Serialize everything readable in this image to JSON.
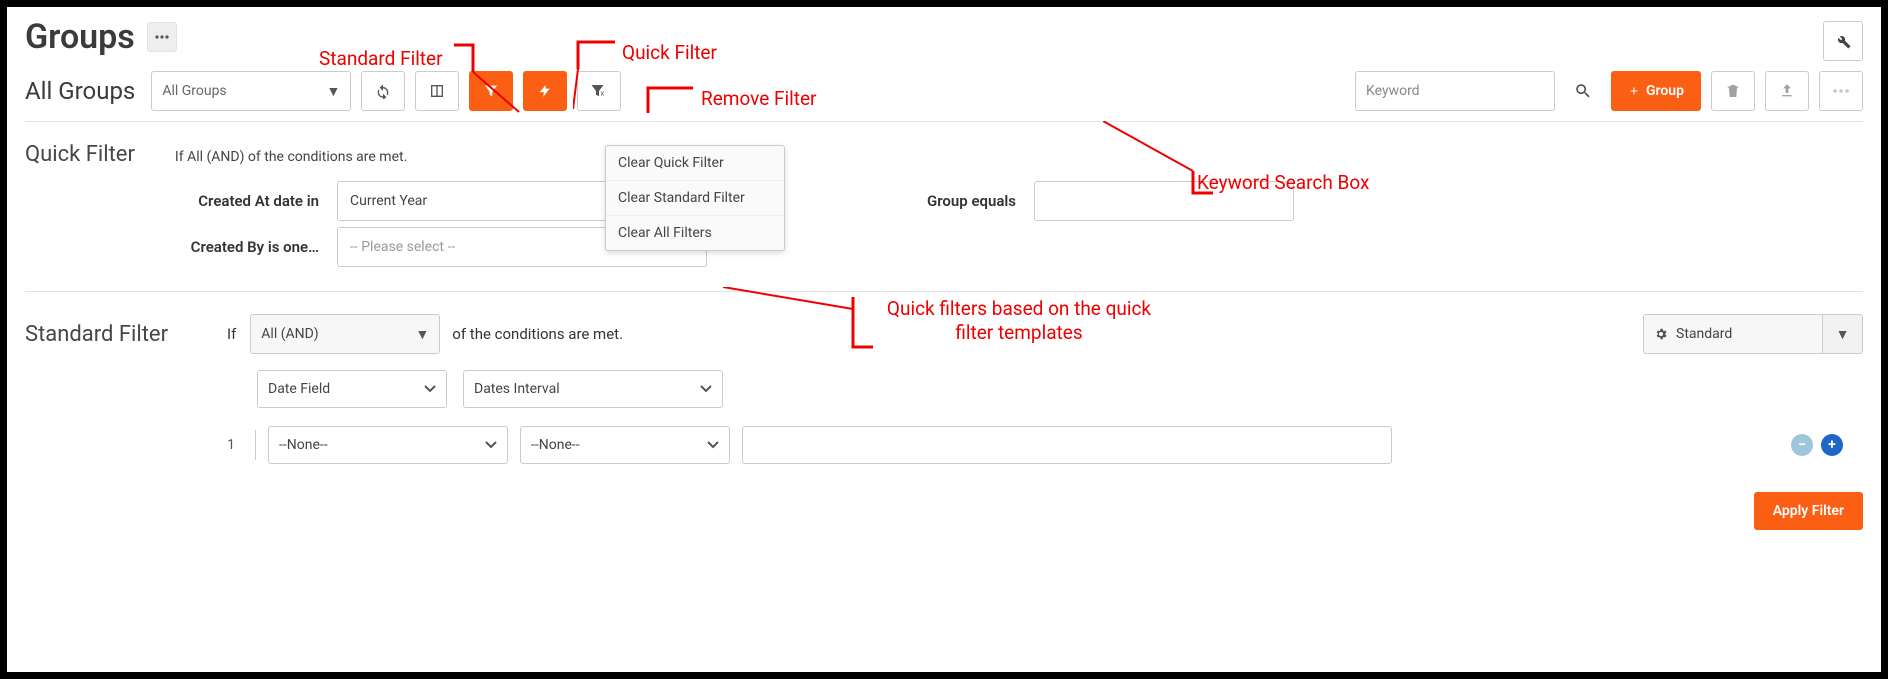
{
  "header": {
    "page_title": "Groups"
  },
  "toolbar": {
    "view_title": "All Groups",
    "view_select": "All Groups",
    "keyword_placeholder": "Keyword",
    "add_group_label": "Group"
  },
  "remove_filter_menu": {
    "items": [
      "Clear Quick Filter",
      "Clear Standard Filter",
      "Clear All Filters"
    ]
  },
  "quick_filter": {
    "heading": "Quick Filter",
    "condition_text": "If All (AND) of the conditions are met.",
    "fields": {
      "created_at_label": "Created At date in",
      "created_at_value": "Current Year",
      "created_by_label": "Created By is one…",
      "created_by_placeholder": "-- Please select --",
      "group_equals_label": "Group equals",
      "group_equals_value": ""
    }
  },
  "standard_filter": {
    "heading": "Standard Filter",
    "if_label": "If",
    "logic_value": "All (AND)",
    "condition_text": "of the conditions are met.",
    "type_label": "Standard",
    "date_field": "Date Field",
    "dates_interval": "Dates Interval",
    "row_index": "1",
    "none1": "--None--",
    "none2": "--None--",
    "apply_label": "Apply Filter"
  },
  "callouts": {
    "standard_filter": "Standard Filter",
    "quick_filter": "Quick Filter",
    "remove_filter": "Remove Filter",
    "keyword_search": "Keyword Search Box",
    "quick_templates_l1": "Quick filters based on the quick",
    "quick_templates_l2": "filter templates"
  }
}
